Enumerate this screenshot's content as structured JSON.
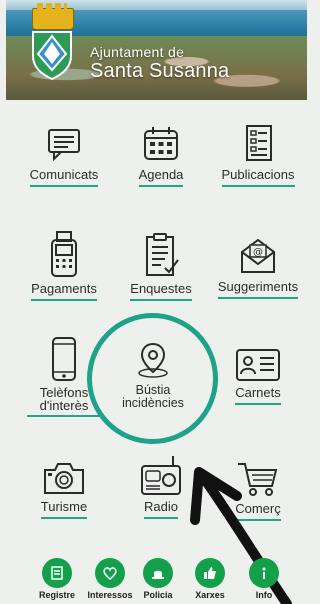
{
  "header": {
    "title_line1": "Ajuntament de",
    "title_line2": "Santa Susanna"
  },
  "tiles": [
    {
      "name": "Comunicats",
      "icon": "message-board-icon"
    },
    {
      "name": "Agenda",
      "icon": "calendar-icon"
    },
    {
      "name": "Publicacions",
      "icon": "document-icon"
    },
    {
      "name": "Pagaments",
      "icon": "pos-terminal-icon"
    },
    {
      "name": "Enquestes",
      "icon": "survey-icon"
    },
    {
      "name": "Suggeriments",
      "icon": "email-icon"
    },
    {
      "name": "Telèfons d'interès",
      "icon": "mobile-phone-icon"
    },
    {
      "name": "Bústia incidències",
      "icon": "location-pin-icon"
    },
    {
      "name": "Carnets",
      "icon": "id-card-icon"
    },
    {
      "name": "Turisme",
      "icon": "camera-icon"
    },
    {
      "name": "Radio",
      "icon": "radio-icon"
    },
    {
      "name": "Comerç",
      "icon": "shopping-cart-icon"
    }
  ],
  "bottom_nav": [
    {
      "label": "Registre",
      "icon": "register-icon"
    },
    {
      "label": "Interessos",
      "icon": "heart-icon"
    },
    {
      "label": "Policia",
      "icon": "police-light-icon"
    },
    {
      "label": "Xarxes",
      "icon": "thumbs-up-icon"
    },
    {
      "label": "Info",
      "icon": "info-icon"
    }
  ],
  "colors": {
    "accent": "#23a488",
    "nav_green": "#14a04a",
    "highlight_ring": "#1fa388"
  }
}
